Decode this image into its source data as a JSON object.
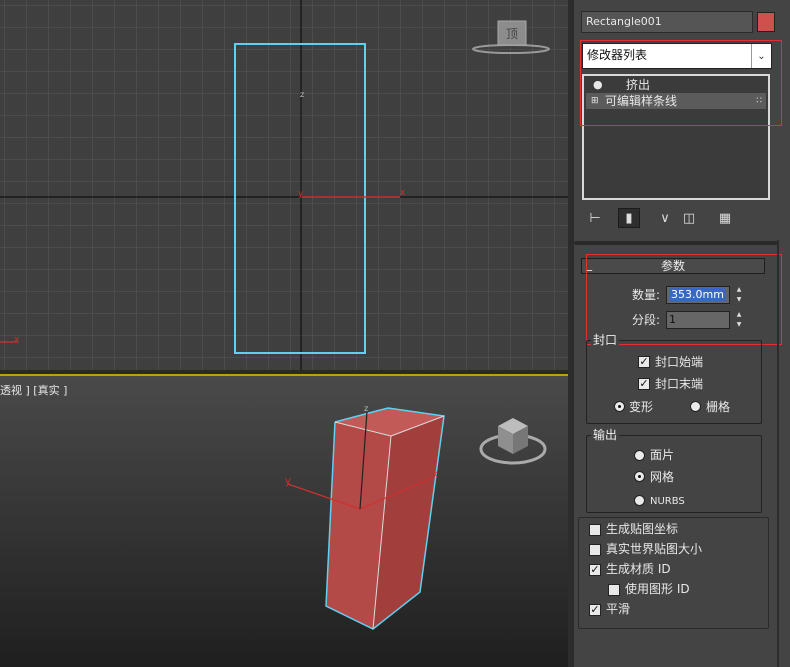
{
  "viewports": {
    "perspective_label": "透视 ] [真实 ]",
    "top_gizmo_label": "顶",
    "top_axis": {
      "x": "x",
      "y": "y",
      "z": "z"
    },
    "persp_axis": {
      "x": "x",
      "y": "y",
      "z": "z"
    }
  },
  "panel": {
    "object_name": "Rectangle001",
    "object_color": "#d0504e",
    "modifier_list_label": "修改器列表",
    "stack": [
      {
        "label": "挤出",
        "icon": "lightbulb-icon"
      },
      {
        "label": "可编辑样条线",
        "icon": "plus-box-icon"
      }
    ],
    "toolbar": [
      "pin-stack-icon",
      "show-end-result-icon",
      "make-unique-icon",
      "remove-modifier-icon",
      "configure-sets-icon"
    ],
    "rollout_title": "参数",
    "amount_label": "数量:",
    "amount_value": "353.0mm",
    "segments_label": "分段:",
    "segments_value": "1",
    "capping": {
      "title": "封口",
      "cap_start": "封口始端",
      "cap_end": "封口末端",
      "morph": "变形",
      "grid": "栅格",
      "cap_start_checked": true,
      "cap_end_checked": true,
      "selected": "变形"
    },
    "output": {
      "title": "输出",
      "patch": "面片",
      "mesh": "网格",
      "nurbs": "NURBS",
      "selected": "网格"
    },
    "options": {
      "gen_mapping": "生成贴图坐标",
      "real_world": "真实世界贴图大小",
      "gen_mat_id": "生成材质 ID",
      "use_shape_id": "使用图形 ID",
      "smooth": "平滑",
      "gen_mapping_checked": false,
      "real_world_checked": false,
      "gen_mat_id_checked": true,
      "use_shape_id_checked": false,
      "smooth_checked": true
    },
    "colors": {
      "highlight_box": "#e03030",
      "selection_outline": "#5fd0f0",
      "object_fill": "#c0504e",
      "active_viewport_border": "#c4a000"
    }
  }
}
